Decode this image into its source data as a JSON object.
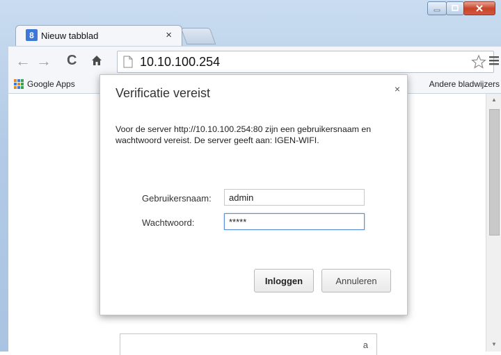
{
  "window": {
    "controls": [
      "minimize-icon",
      "maximize-icon",
      "close-icon"
    ]
  },
  "tab": {
    "favicon_glyph": "8",
    "title": "Nieuw tabblad",
    "close_glyph": "×"
  },
  "toolbar": {
    "back_glyph": "←",
    "forward_glyph": "→",
    "reload_glyph": "C",
    "url": "10.10.100.254"
  },
  "bookmarks": {
    "apps_label": "Google Apps",
    "other_label": "Andere bladwijzers"
  },
  "dialog": {
    "title": "Verificatie vereist",
    "close_glyph": "×",
    "message": "Voor de server http://10.10.100.254:80 zijn een gebruikersnaam en wachtwoord vereist. De server geeft aan: IGEN-WIFI.",
    "username_label": "Gebruikersnaam:",
    "username_value": "admin",
    "password_label": "Wachtwoord:",
    "password_value": "*****",
    "login_button": "Inloggen",
    "cancel_button": "Annuleren"
  },
  "page_box": {
    "glyph": "a"
  },
  "colors": {
    "frame": "#b3cbe6",
    "close_button": "#c7452b",
    "focus_border": "#5d8fd6"
  }
}
